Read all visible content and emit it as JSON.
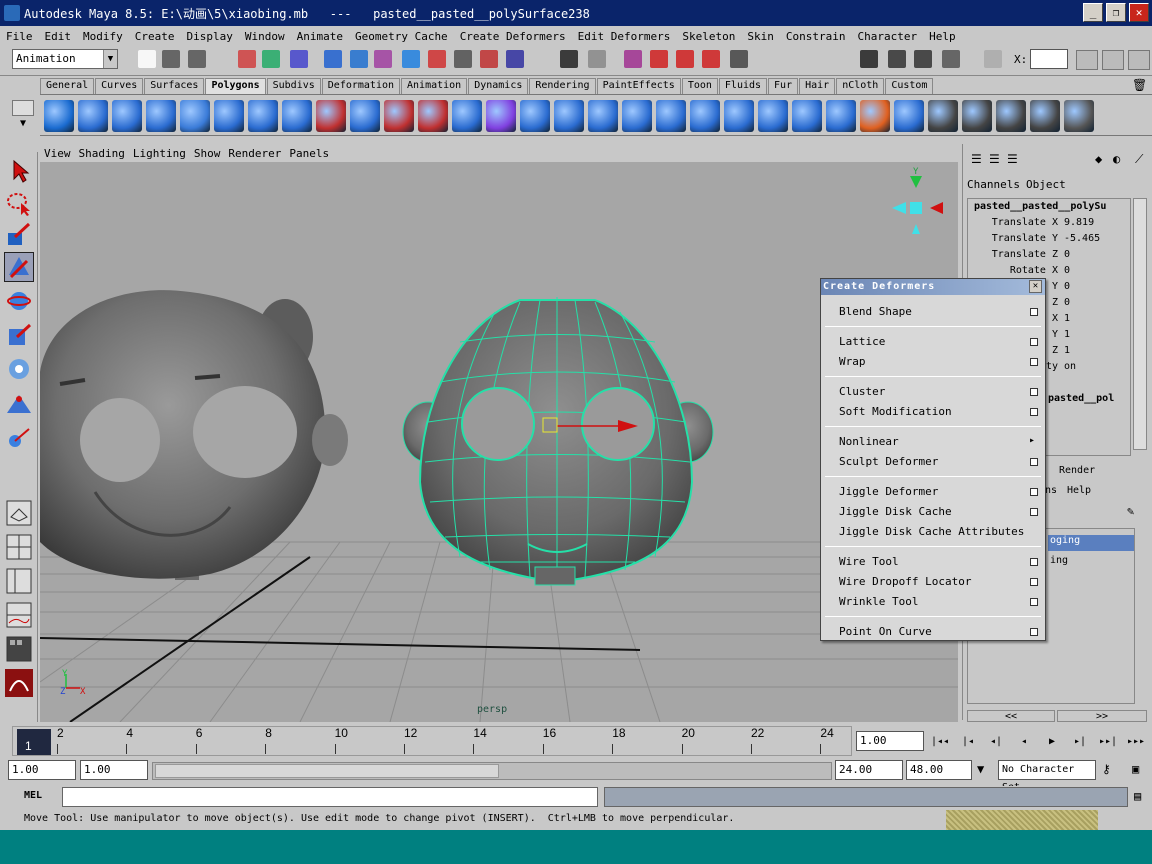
{
  "window": {
    "title": "Autodesk Maya 8.5: E:\\动画\\5\\xiaobing.mb   ---   pasted__pasted__polySurface238",
    "minimize": "_",
    "maximize": "❐",
    "close": "✕"
  },
  "menubar": [
    "File",
    "Edit",
    "Modify",
    "Create",
    "Display",
    "Window",
    "Animate",
    "Geometry Cache",
    "Create Deformers",
    "Edit Deformers",
    "Skeleton",
    "Skin",
    "Constrain",
    "Character",
    "Help"
  ],
  "status_line": {
    "mode": "Animation",
    "x_label": "X:"
  },
  "shelf_tabs": [
    {
      "label": "General",
      "active": false
    },
    {
      "label": "Curves",
      "active": false
    },
    {
      "label": "Surfaces",
      "active": false
    },
    {
      "label": "Polygons",
      "active": true
    },
    {
      "label": "Subdivs",
      "active": false
    },
    {
      "label": "Deformation",
      "active": false
    },
    {
      "label": "Animation",
      "active": false
    },
    {
      "label": "Dynamics",
      "active": false
    },
    {
      "label": "Rendering",
      "active": false
    },
    {
      "label": "PaintEffects",
      "active": false
    },
    {
      "label": "Toon",
      "active": false
    },
    {
      "label": "Fluids",
      "active": false
    },
    {
      "label": "Fur",
      "active": false
    },
    {
      "label": "Hair",
      "active": false
    },
    {
      "label": "nCloth",
      "active": false
    },
    {
      "label": "Custom",
      "active": false
    }
  ],
  "panel_menu": [
    "View",
    "Shading",
    "Lighting",
    "Show",
    "Renderer",
    "Panels"
  ],
  "viewport": {
    "camera_label": "persp",
    "axis_y": "Y",
    "axis_x": "X",
    "axis_z": "Z"
  },
  "channel_box": {
    "tabs": [
      "Channels",
      "Object"
    ],
    "object_name": "pasted__pasted__polySu",
    "attributes": [
      {
        "label": "Translate X",
        "value": "9.819"
      },
      {
        "label": "Translate Y",
        "value": "-5.465"
      },
      {
        "label": "Translate Z",
        "value": "0"
      },
      {
        "label": "Rotate X",
        "value": "0"
      },
      {
        "label": "Y",
        "value": "0"
      },
      {
        "label": "Z",
        "value": "0"
      },
      {
        "label": "X",
        "value": "1"
      },
      {
        "label": "Y",
        "value": "1"
      },
      {
        "label": "Z",
        "value": "1"
      },
      {
        "label": "ty",
        "value": "on"
      }
    ],
    "shape_name": "pasted__pol",
    "layer_tab_render": "Render",
    "layer_menu_ns": "ns",
    "layer_menu_help": "Help",
    "layer_item_1": "oging",
    "layer_item_2": "ing",
    "scroll_left": "<<",
    "scroll_right": ">>"
  },
  "create_deformers_menu": {
    "title": "Create Deformers",
    "close": "✕",
    "submenu_arrow": "▸",
    "items": [
      "Blend Shape",
      "Lattice",
      "Wrap",
      "Cluster",
      "Soft Modification",
      "Nonlinear",
      "Sculpt Deformer",
      "Jiggle Deformer",
      "Jiggle Disk Cache",
      "Jiggle Disk Cache Attributes",
      "Wire Tool",
      "Wire Dropoff Locator",
      "Wrinkle Tool",
      "Point On Curve"
    ]
  },
  "timeline": {
    "current_frame": "1",
    "ticks": [
      "2",
      "4",
      "6",
      "8",
      "10",
      "12",
      "14",
      "16",
      "18",
      "20",
      "22",
      "24"
    ],
    "current_time_field": "1.00"
  },
  "range": {
    "start": "1.00",
    "playback_start": "1.00",
    "playback_end": "24.00",
    "end": "48.00",
    "character_set": "No Character Set"
  },
  "command_line": {
    "label": "MEL"
  },
  "help_line": "Move Tool: Use manipulator to move object(s). Use edit mode to change pivot (INSERT).  Ctrl+LMB to move perpendicular.",
  "playback_buttons": [
    "|◂◂",
    "|◂",
    "◂|",
    "◂",
    "▶",
    "▸|",
    "▸▸|",
    "▸▸▸"
  ]
}
